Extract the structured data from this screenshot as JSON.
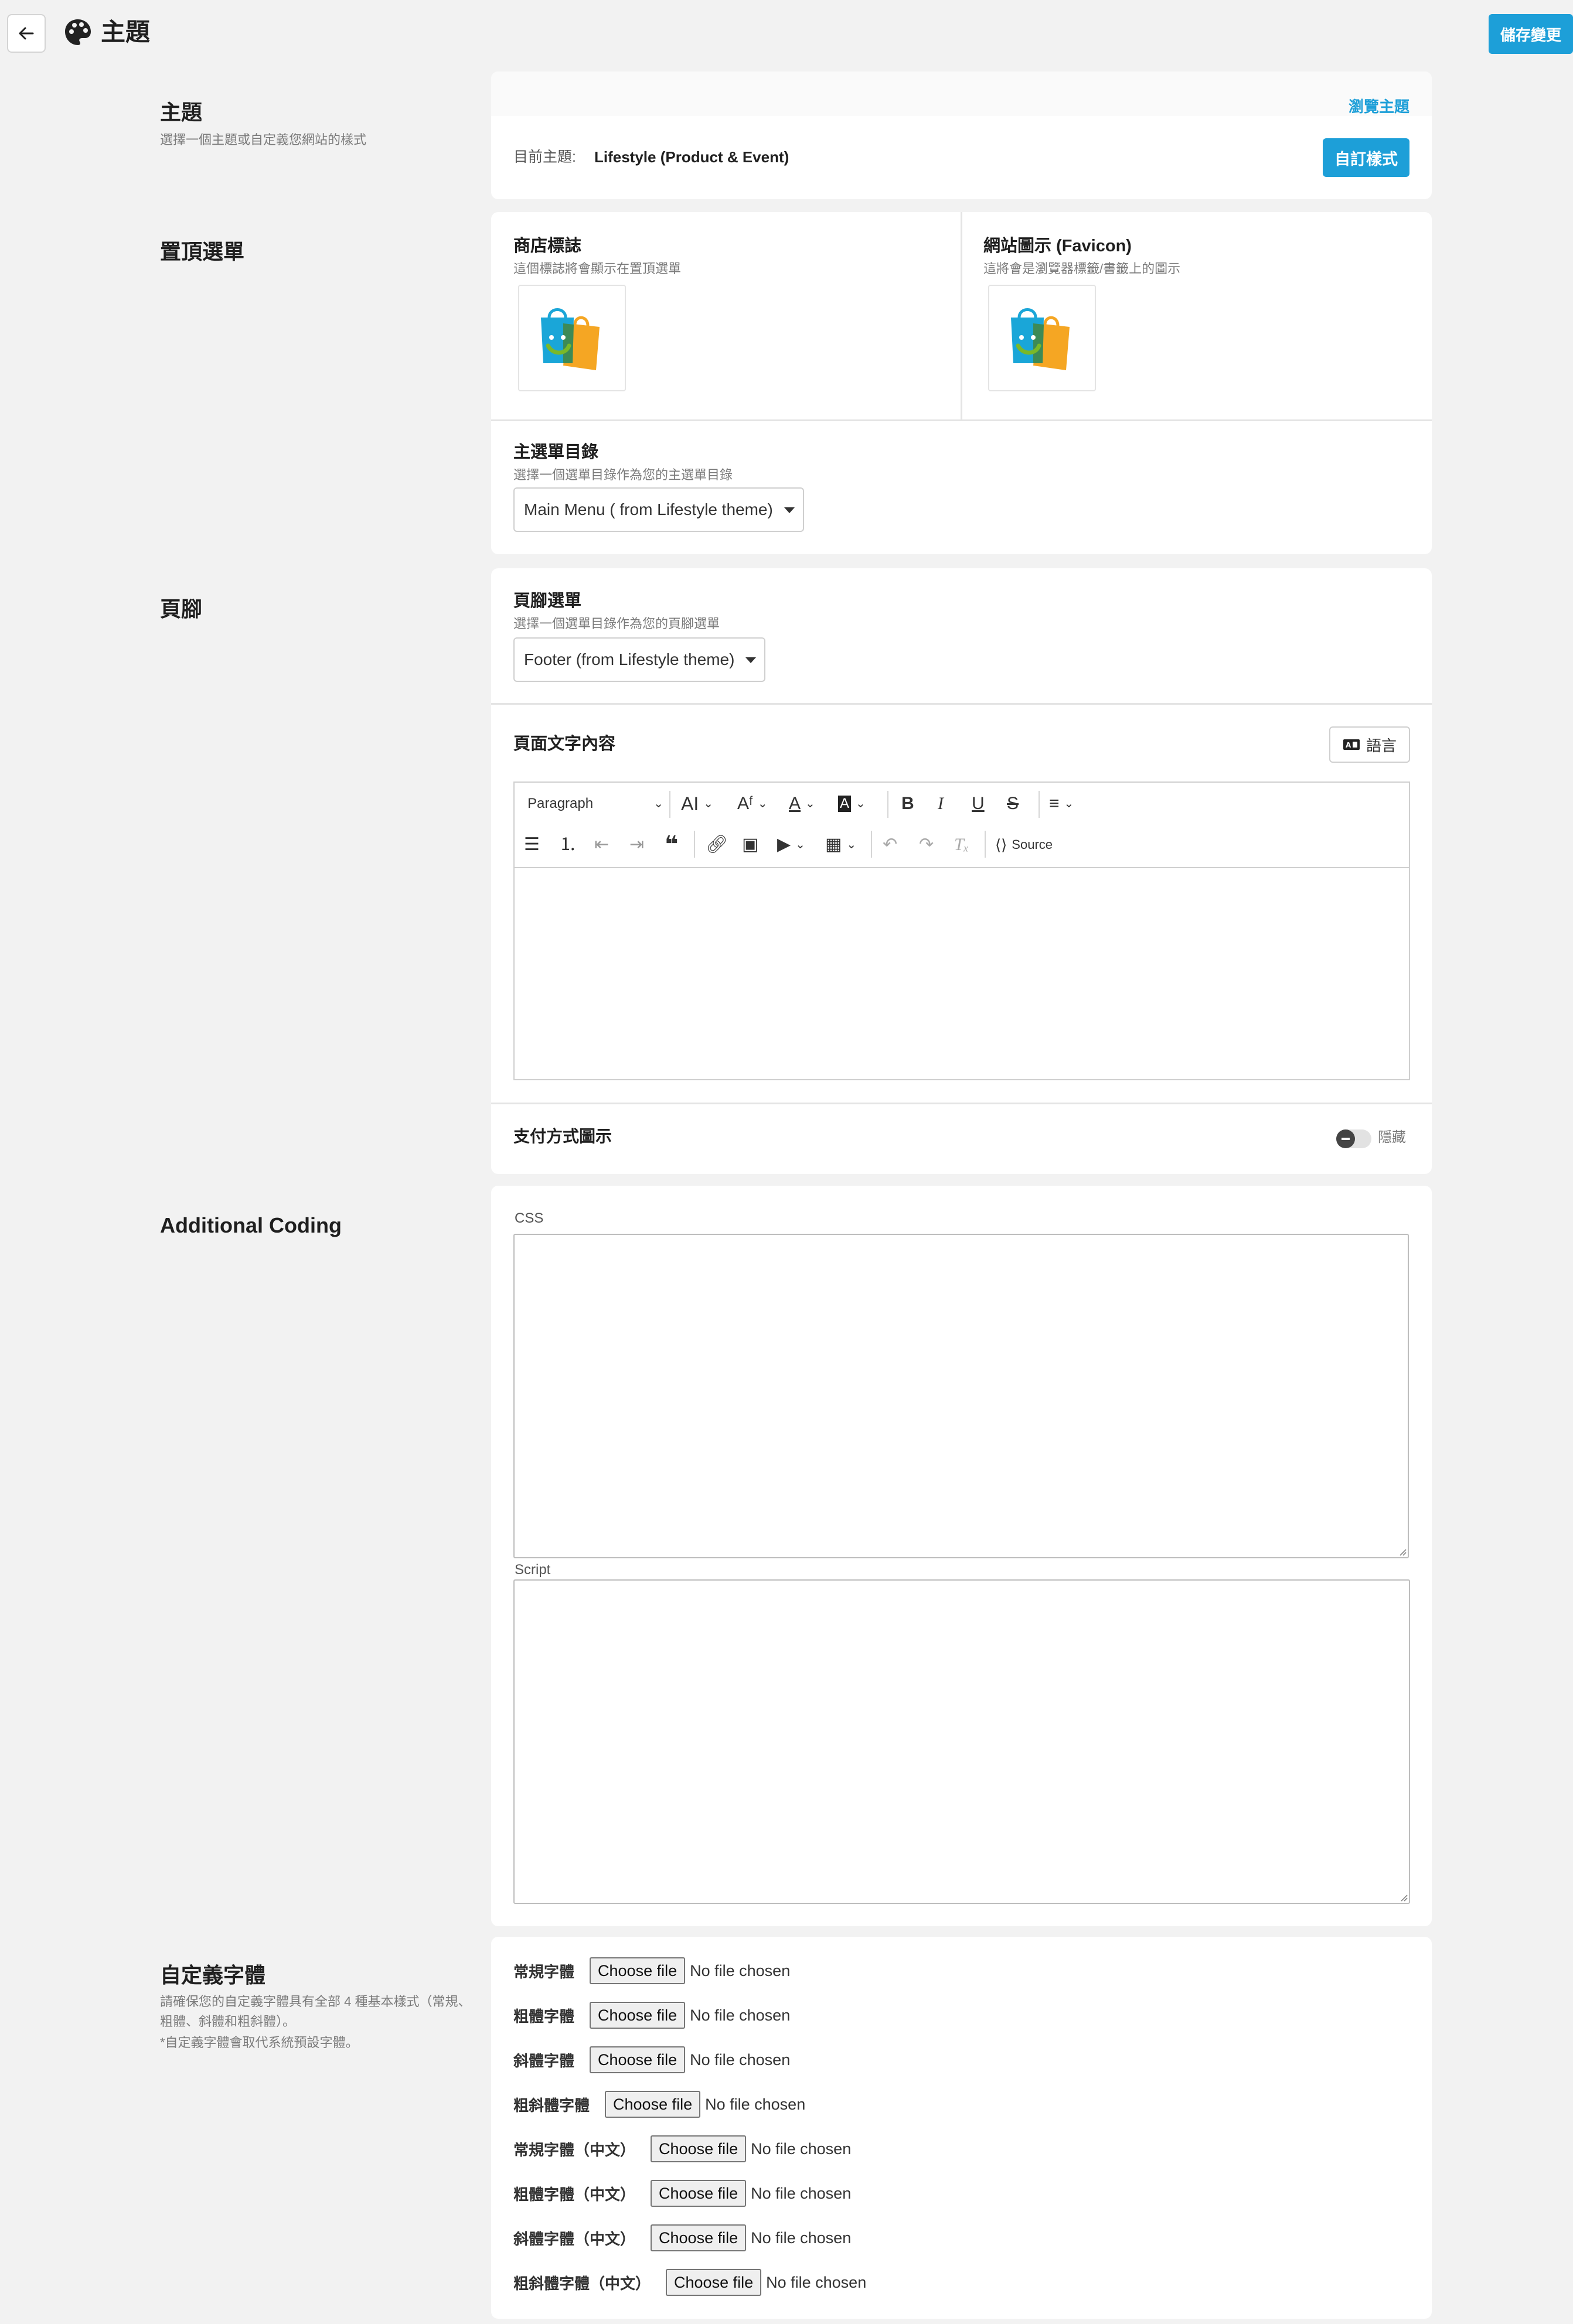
{
  "header": {
    "title": "主題",
    "save_label": "儲存變更",
    "back_icon": "arrow-left-icon",
    "title_icon": "palette-icon"
  },
  "theme_section": {
    "title": "主題",
    "desc": "選擇一個主題或自定義您網站的樣式",
    "preview_link": "瀏覽主題",
    "current_label": "目前主題:",
    "current_value": "Lifestyle (Product & Event)",
    "customize_label": "自訂樣式"
  },
  "topmenu_section": {
    "title": "置頂選單",
    "store_logo_title": "商店標誌",
    "store_logo_desc": "這個標誌將會顯示在置頂選單",
    "favicon_title": "網站圖示 (Favicon)",
    "favicon_desc": "這將會是瀏覽器標籤/書籤上的圖示",
    "main_menu_title": "主選單目錄",
    "main_menu_desc": "選擇一個選單目錄作為您的主選單目錄",
    "main_menu_value": "Main Menu ( from Lifestyle theme)"
  },
  "footer_section": {
    "title": "頁腳",
    "footer_menu_title": "頁腳選單",
    "footer_menu_desc": "選擇一個選單目錄作為您的頁腳選單",
    "footer_menu_value": "Footer (from Lifestyle theme)",
    "page_text_title": "頁面文字內容",
    "language_label": "語言",
    "payment_title": "支付方式圖示",
    "payment_toggle_label": "隱藏",
    "editor": {
      "paragraph_label": "Paragraph",
      "source_label": "Source"
    }
  },
  "coding_section": {
    "title": "Additional Coding",
    "css_label": "CSS",
    "script_label": "Script"
  },
  "font_section": {
    "title": "自定義字體",
    "desc1": "請確保您的自定義字體具有全部 4 種基本樣式（常規、粗體、斜體和粗斜體）。",
    "desc2": "*自定義字體會取代系統預設字體。",
    "choose_file": "Choose file",
    "no_file": "No file chosen",
    "rows": [
      {
        "label": "常規字體"
      },
      {
        "label": "粗體字體"
      },
      {
        "label": "斜體字體"
      },
      {
        "label": "粗斜體字體"
      },
      {
        "label": "常規字體（中文）"
      },
      {
        "label": "粗體字體（中文）"
      },
      {
        "label": "斜體字體（中文）"
      },
      {
        "label": "粗斜體字體（中文）"
      }
    ]
  },
  "colors": {
    "accent": "#1d9fd8",
    "background": "#f2f2f2",
    "card": "#ffffff",
    "logo_blue": "#1aa6d8",
    "logo_orange": "#f5a623",
    "logo_green": "#7ab829"
  }
}
